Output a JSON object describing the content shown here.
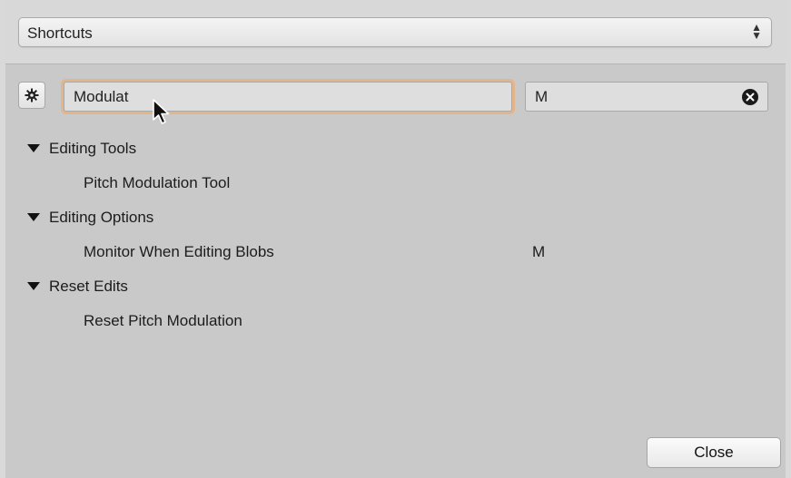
{
  "dialog": {
    "category_select": {
      "selected": "Shortcuts",
      "icon": "up-down-arrows-icon"
    },
    "search": {
      "value": "Modulat",
      "icon": "gear-icon"
    },
    "key_filter": {
      "value": "M",
      "clear_icon": "clear-circle-icon"
    },
    "groups": [
      {
        "label": "Editing Tools",
        "items": [
          {
            "label": "Pitch Modulation Tool",
            "key": ""
          }
        ]
      },
      {
        "label": "Editing Options",
        "items": [
          {
            "label": "Monitor When Editing Blobs",
            "key": "M"
          }
        ]
      },
      {
        "label": "Reset Edits",
        "items": [
          {
            "label": "Reset Pitch Modulation",
            "key": ""
          }
        ]
      }
    ],
    "close_label": "Close",
    "colors": {
      "background": "#c9c9c9",
      "focus_ring": "#e4b58a"
    }
  }
}
